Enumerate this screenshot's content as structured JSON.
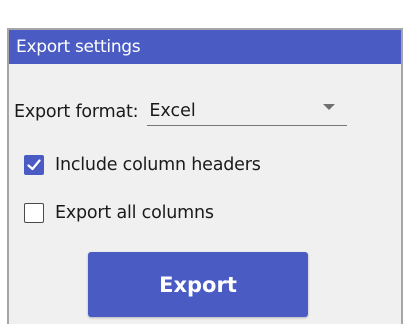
{
  "panel": {
    "title": "Export settings"
  },
  "format": {
    "label": "Export format:",
    "selected": "Excel",
    "caret_icon": "chevron-down-icon"
  },
  "options": {
    "include_headers": {
      "label": "Include column headers",
      "checked": true
    },
    "export_all_columns": {
      "label": "Export all columns",
      "checked": false
    }
  },
  "actions": {
    "export_label": "Export"
  },
  "colors": {
    "accent": "#4a5cc4",
    "panel_background": "#f0f0f0",
    "border": "#a6a6a6"
  }
}
